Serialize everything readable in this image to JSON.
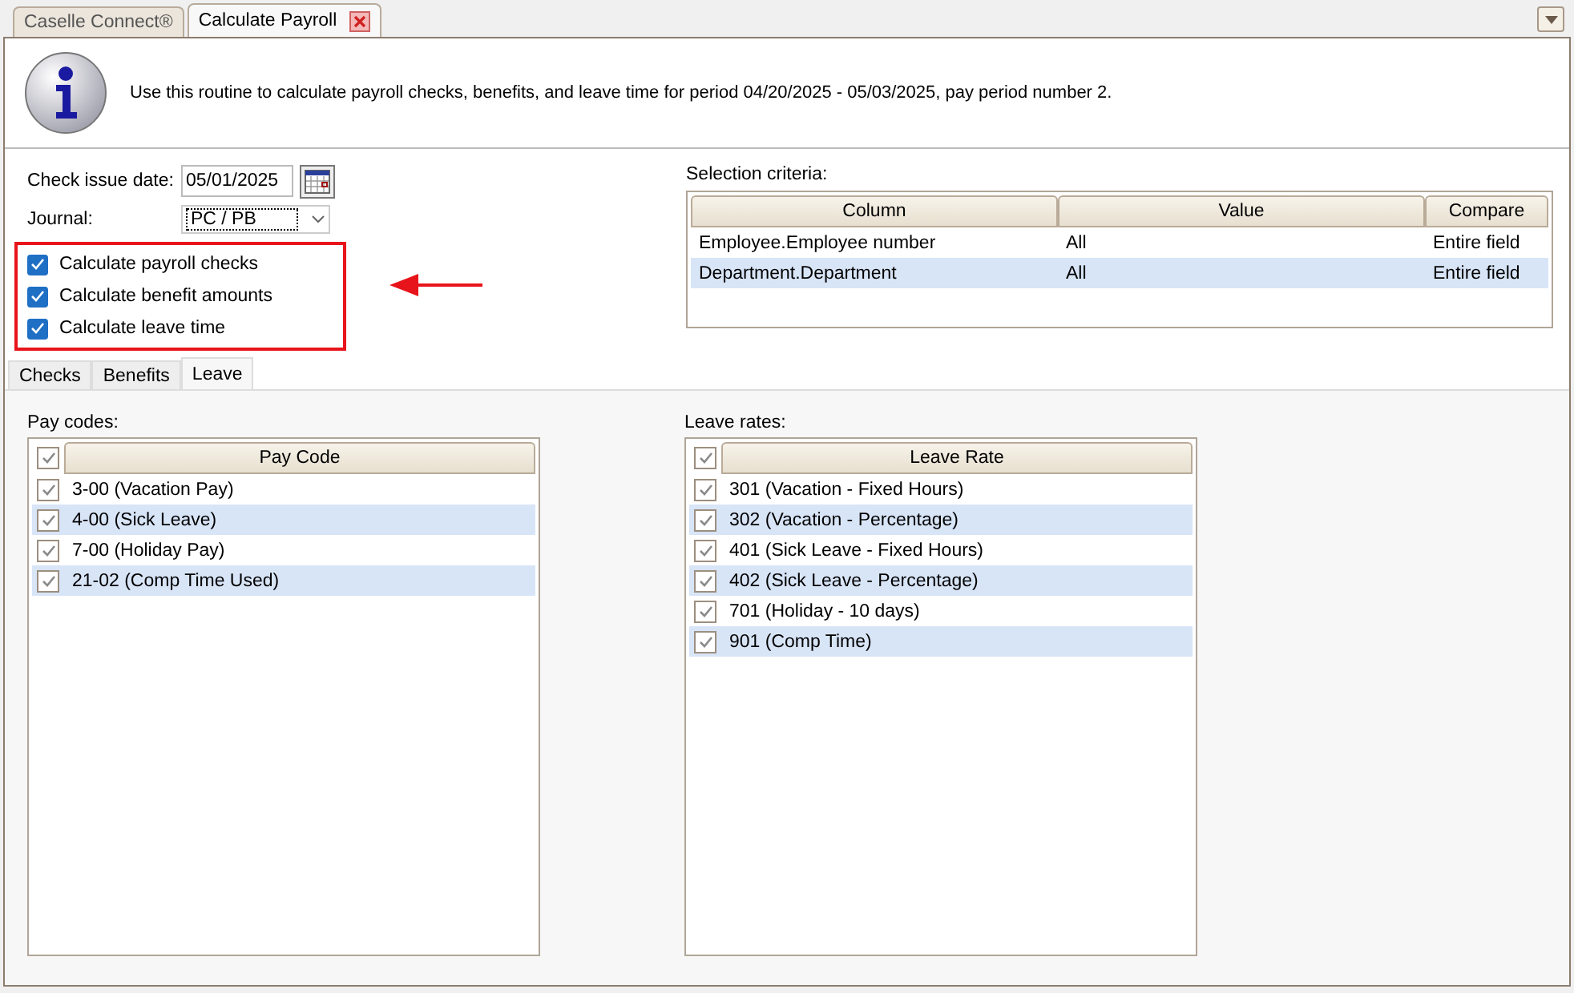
{
  "doc_tabs": [
    {
      "label": "Caselle Connect®",
      "selected": false,
      "closable": false
    },
    {
      "label": "Calculate Payroll",
      "selected": true,
      "closable": true
    }
  ],
  "info": {
    "text": "Use this routine to calculate payroll checks, benefits, and leave time for period 04/20/2025 - 05/03/2025, pay period number 2."
  },
  "form": {
    "check_issue_date": {
      "label": "Check issue date:",
      "value": "05/01/2025"
    },
    "journal": {
      "label": "Journal:",
      "value": "PC / PB"
    }
  },
  "options": [
    {
      "label": "Calculate payroll checks",
      "checked": true
    },
    {
      "label": "Calculate benefit amounts",
      "checked": true
    },
    {
      "label": "Calculate leave time",
      "checked": true
    }
  ],
  "selection_criteria": {
    "label": "Selection criteria:",
    "columns": [
      "Column",
      "Value",
      "Compare"
    ],
    "rows": [
      [
        "Employee.Employee number",
        "All",
        "Entire field"
      ],
      [
        "Department.Department",
        "All",
        "Entire field"
      ]
    ]
  },
  "tabs": [
    {
      "label": "Checks",
      "selected": false
    },
    {
      "label": "Benefits",
      "selected": false
    },
    {
      "label": "Leave",
      "selected": true
    }
  ],
  "pay_codes": {
    "label": "Pay codes:",
    "header_checked": true,
    "column": "Pay Code",
    "rows": [
      {
        "text": "3-00 (Vacation Pay)",
        "checked": true
      },
      {
        "text": "4-00 (Sick Leave)",
        "checked": true
      },
      {
        "text": "7-00 (Holiday Pay)",
        "checked": true
      },
      {
        "text": "21-02 (Comp Time Used)",
        "checked": true
      }
    ]
  },
  "leave_rates": {
    "label": "Leave rates:",
    "header_checked": true,
    "column": "Leave Rate",
    "rows": [
      {
        "text": "301 (Vacation - Fixed Hours)",
        "checked": true
      },
      {
        "text": "302 (Vacation - Percentage)",
        "checked": true
      },
      {
        "text": "401 (Sick Leave - Fixed Hours)",
        "checked": true
      },
      {
        "text": "402 (Sick Leave - Percentage)",
        "checked": true
      },
      {
        "text": "701 (Holiday - 10 days)",
        "checked": true
      },
      {
        "text": "901 (Comp Time)",
        "checked": true
      }
    ]
  }
}
